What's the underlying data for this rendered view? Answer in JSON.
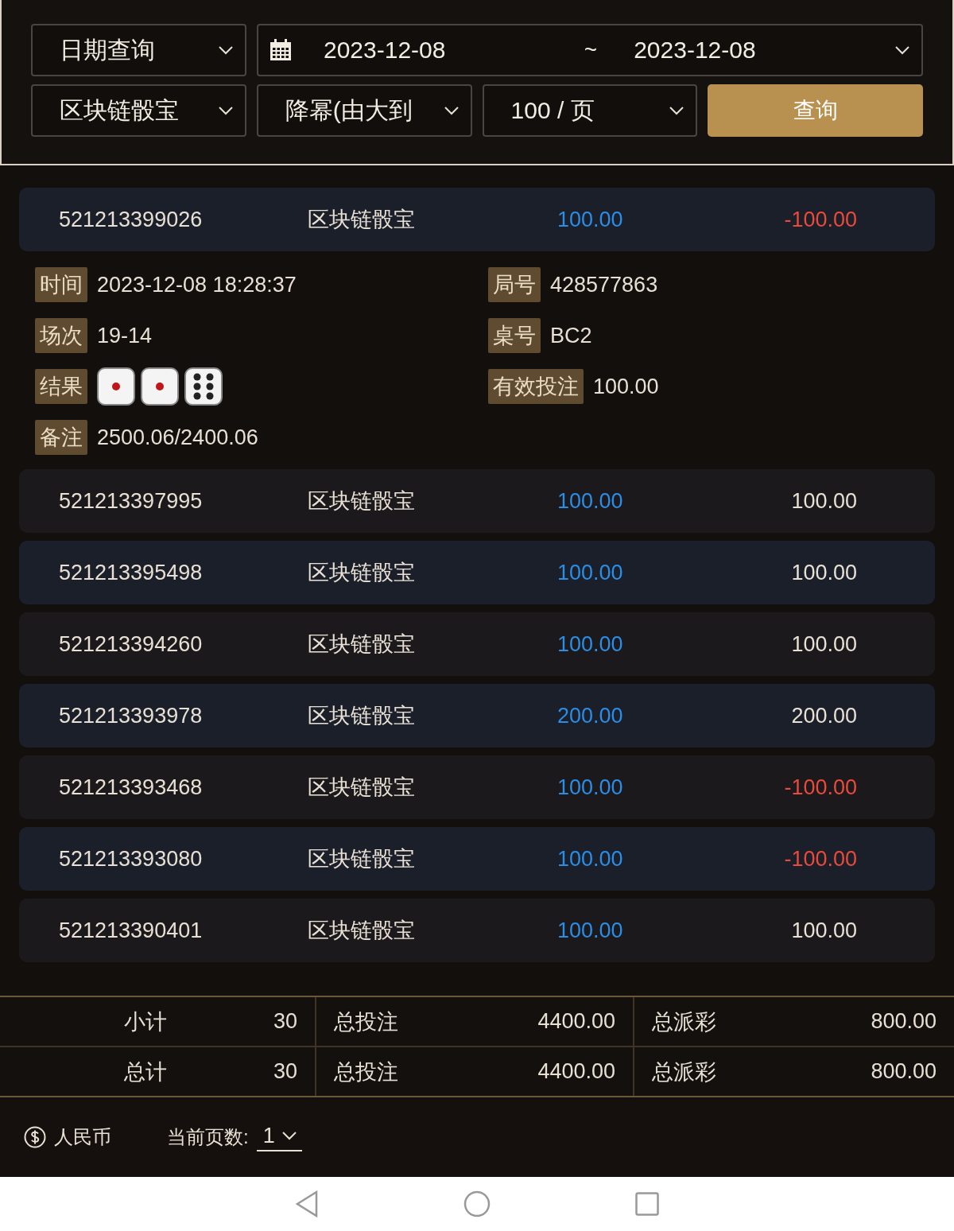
{
  "filters": {
    "query_type": "日期查询",
    "date_from": "2023-12-08",
    "date_separator": "~",
    "date_to": "2023-12-08",
    "game": "区块链骰宝",
    "sort": "降幂(由大到",
    "page_size": "100 / 页",
    "query_button": "查询"
  },
  "rows": [
    {
      "id": "521213399026",
      "game": "区块链骰宝",
      "bet": "100.00",
      "payout": "-100.00",
      "negative": true,
      "details": {
        "time_label": "时间",
        "time": "2023-12-08 18:28:37",
        "round_label": "局号",
        "round": "428577863",
        "session_label": "场次",
        "session": "19-14",
        "table_label": "桌号",
        "table": "BC2",
        "result_label": "结果",
        "dice": [
          {
            "kind": "one"
          },
          {
            "kind": "one"
          },
          {
            "kind": "six"
          }
        ],
        "valid_bet_label": "有效投注",
        "valid_bet": "100.00",
        "note_label": "备注",
        "note": "2500.06/2400.06"
      }
    },
    {
      "id": "521213397995",
      "game": "区块链骰宝",
      "bet": "100.00",
      "payout": "100.00",
      "negative": false
    },
    {
      "id": "521213395498",
      "game": "区块链骰宝",
      "bet": "100.00",
      "payout": "100.00",
      "negative": false
    },
    {
      "id": "521213394260",
      "game": "区块链骰宝",
      "bet": "100.00",
      "payout": "100.00",
      "negative": false
    },
    {
      "id": "521213393978",
      "game": "区块链骰宝",
      "bet": "200.00",
      "payout": "200.00",
      "negative": false
    },
    {
      "id": "521213393468",
      "game": "区块链骰宝",
      "bet": "100.00",
      "payout": "-100.00",
      "negative": true
    },
    {
      "id": "521213393080",
      "game": "区块链骰宝",
      "bet": "100.00",
      "payout": "-100.00",
      "negative": true
    },
    {
      "id": "521213390401",
      "game": "区块链骰宝",
      "bet": "100.00",
      "payout": "100.00",
      "negative": false
    }
  ],
  "summary": [
    {
      "label": "小计",
      "count": "30",
      "bet_label": "总投注",
      "bet": "4400.00",
      "payout_label": "总派彩",
      "payout": "800.00"
    },
    {
      "label": "总计",
      "count": "30",
      "bet_label": "总投注",
      "bet": "4400.00",
      "payout_label": "总派彩",
      "payout": "800.00"
    }
  ],
  "footer": {
    "currency": "人民币",
    "page_label": "当前页数:",
    "page": "1"
  }
}
